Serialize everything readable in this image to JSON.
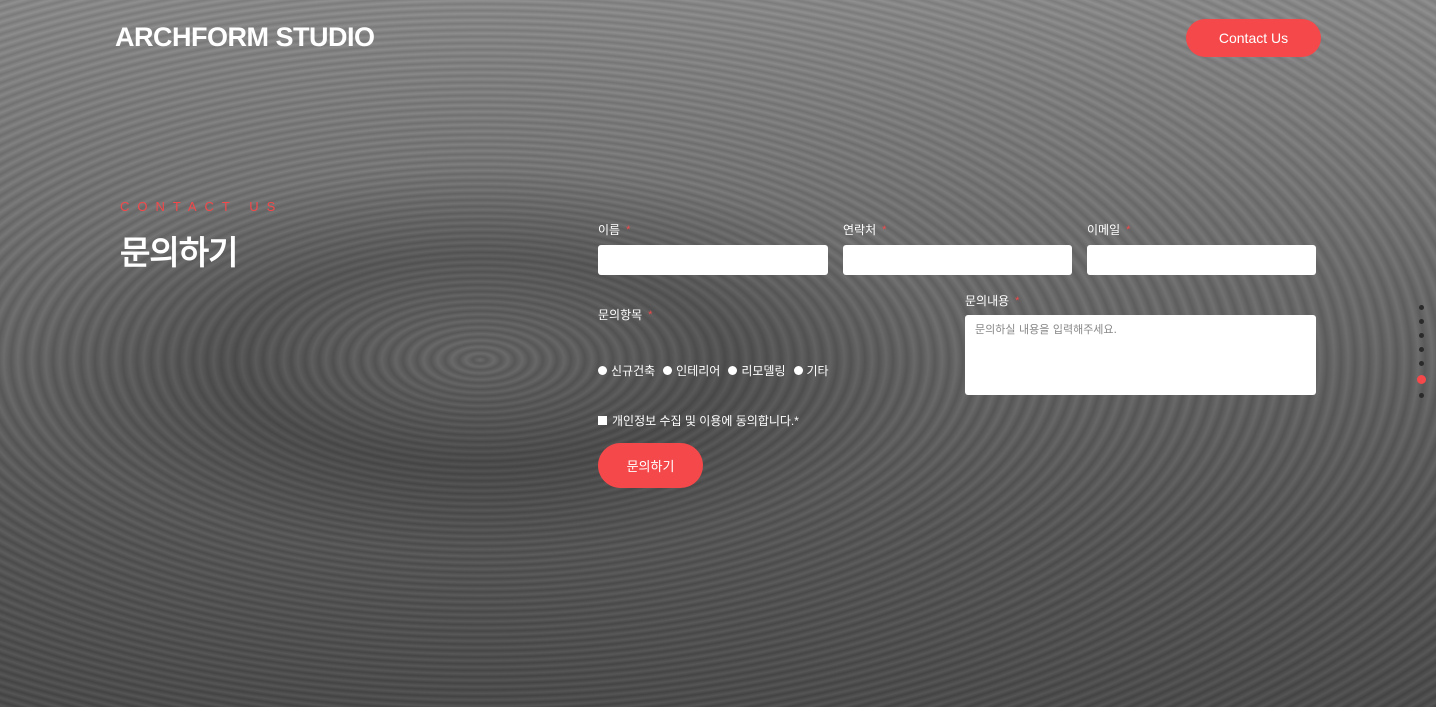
{
  "header": {
    "logo": "ARCHFORM STUDIO",
    "contact_button": "Contact Us"
  },
  "hero": {
    "eyebrow": "CONTACT US",
    "title": "문의하기"
  },
  "form": {
    "name_label": "이름",
    "phone_label": "연락처",
    "email_label": "이메일",
    "category_label": "문의항목",
    "message_label": "문의내용",
    "required_mark": "*",
    "message_placeholder": "문의하실 내용을 입력해주세요.",
    "categories": [
      "신규건축",
      "인테리어",
      "리모델링",
      "기타"
    ],
    "agree_text": "개인정보 수집 및 이용에 동의합니다.*",
    "submit_label": "문의하기"
  },
  "pager": {
    "count": 7,
    "active_index": 5
  },
  "colors": {
    "accent": "#f4484a",
    "text": "#ffffff"
  }
}
